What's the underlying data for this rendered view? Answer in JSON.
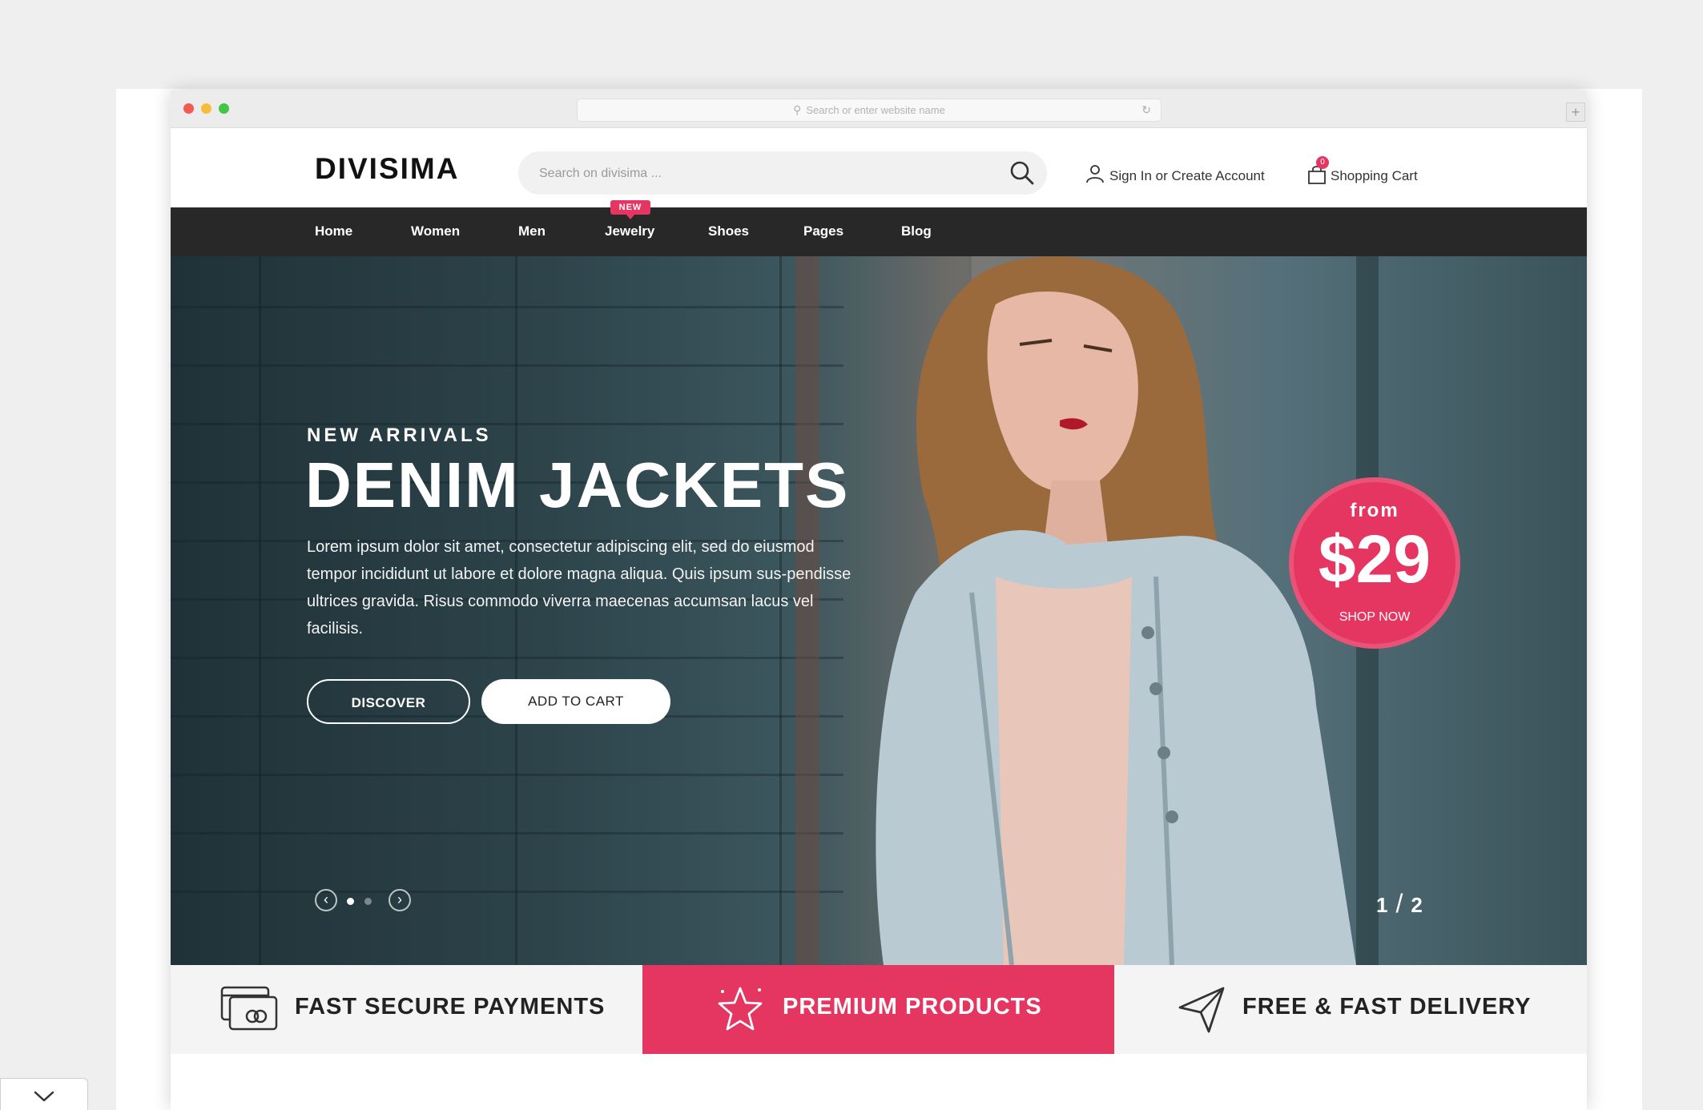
{
  "browser": {
    "address_placeholder": "Search or enter website name"
  },
  "header": {
    "logo": "DIVISIMA",
    "search_placeholder": "Search on divisima ...",
    "signin_label": "Sign In or Create Account",
    "cart_label": "Shopping Cart",
    "cart_count": "0"
  },
  "nav": {
    "items": [
      "Home",
      "Women",
      "Men",
      "Jewelry",
      "Shoes",
      "Pages",
      "Blog"
    ],
    "new_badge": "NEW"
  },
  "hero": {
    "eyebrow": "NEW ARRIVALS",
    "headline": "DENIM JACKETS",
    "body": "Lorem ipsum dolor sit amet, consectetur adipiscing elit, sed do eiusmod tempor incididunt ut labore et dolore magna aliqua. Quis ipsum sus-pendisse ultrices gravida. Risus commodo viverra maecenas accumsan lacus vel facilisis.",
    "discover_label": "DISCOVER",
    "add_to_cart_label": "ADD TO CART",
    "price_from": "from",
    "price": "$29",
    "shop_now": "SHOP NOW",
    "slide_current": "1",
    "slide_separator": "/",
    "slide_total": "2"
  },
  "features": [
    {
      "label": "FAST SECURE PAYMENTS",
      "icon": "credit-card-icon"
    },
    {
      "label": "PREMIUM PRODUCTS",
      "icon": "star-icon"
    },
    {
      "label": "FREE & FAST DELIVERY",
      "icon": "paper-plane-icon"
    }
  ],
  "colors": {
    "accent": "#e53561",
    "nav_bg": "#282828",
    "page_bg": "#efefef"
  }
}
